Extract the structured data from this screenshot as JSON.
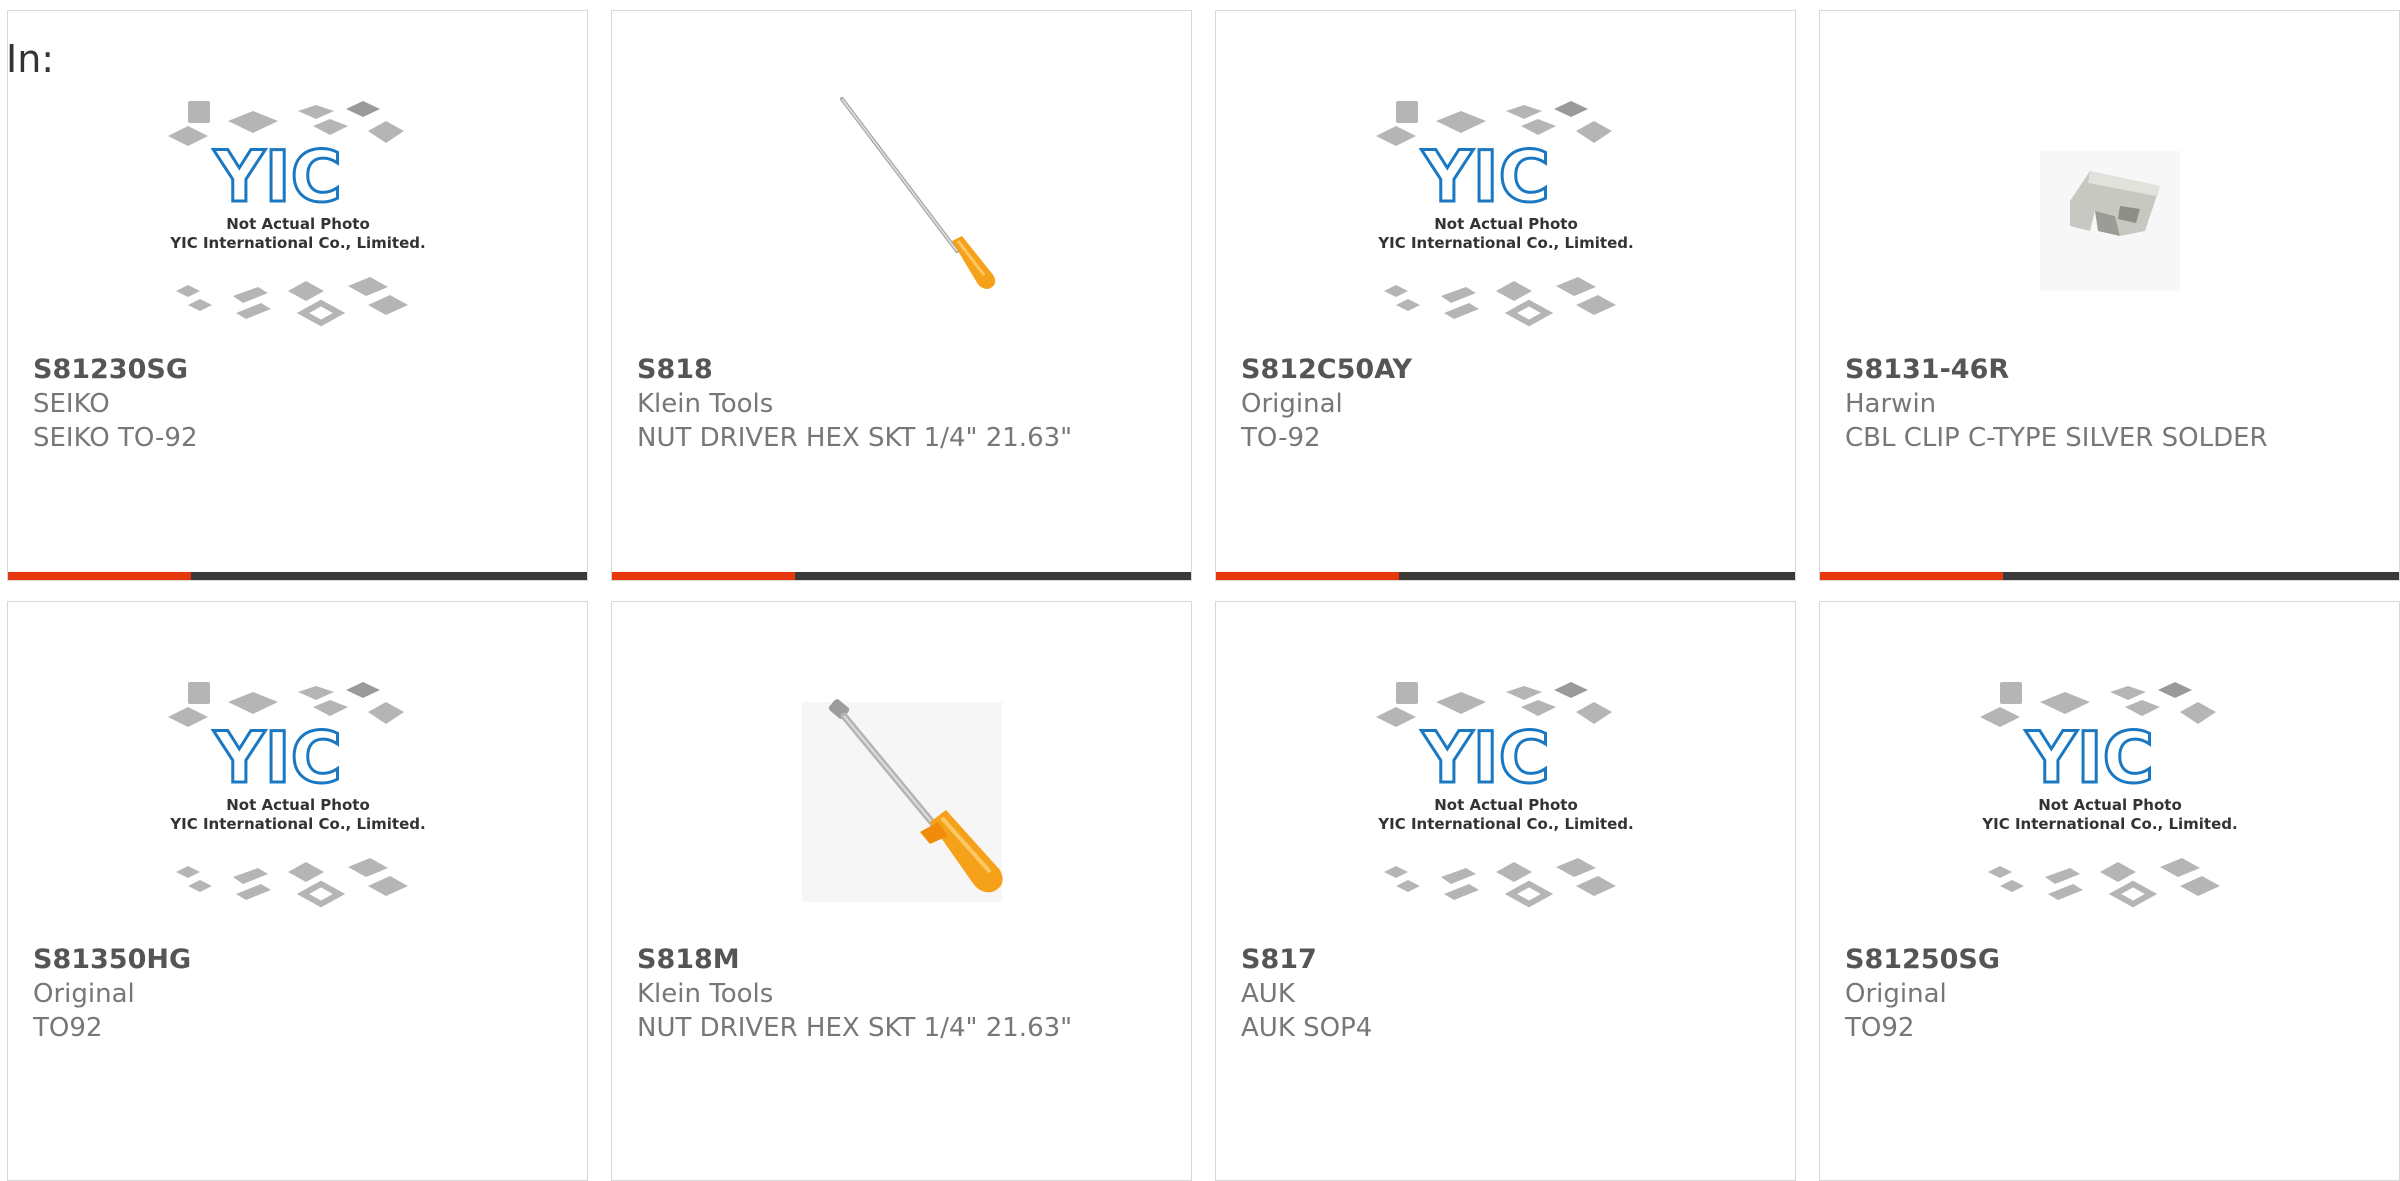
{
  "filter_label": "In:",
  "colors": {
    "accent": "#e8380d",
    "bar": "#3a3a3a",
    "logo_blue": "#1a78c2",
    "chip_gray": "#b0b0b0",
    "handle_orange": "#f5a11a"
  },
  "placeholder_image": {
    "line1": "Not Actual Photo",
    "line2": "YIC International Co., Limited."
  },
  "products": [
    {
      "part": "S81230SG",
      "manufacturer": "SEIKO",
      "description": "SEIKO TO-92",
      "image": "placeholder"
    },
    {
      "part": "S818",
      "manufacturer": "Klein Tools",
      "description": "NUT DRIVER HEX SKT 1/4\" 21.63\"",
      "image": "nut-driver-long"
    },
    {
      "part": "S812C50AY",
      "manufacturer": "Original",
      "description": "TO-92",
      "image": "placeholder"
    },
    {
      "part": "S8131-46R",
      "manufacturer": "Harwin",
      "description": "CBL CLIP C-TYPE SILVER SOLDER",
      "image": "cable-clip"
    },
    {
      "part": "S81350HG",
      "manufacturer": "Original",
      "description": "TO92",
      "image": "placeholder"
    },
    {
      "part": "S818M",
      "manufacturer": "Klein Tools",
      "description": "NUT DRIVER HEX SKT 1/4\" 21.63\"",
      "image": "nut-driver-closeup"
    },
    {
      "part": "S817",
      "manufacturer": "AUK",
      "description": "AUK SOP4",
      "image": "placeholder"
    },
    {
      "part": "S81250SG",
      "manufacturer": "Original",
      "description": "TO92",
      "image": "placeholder"
    }
  ]
}
